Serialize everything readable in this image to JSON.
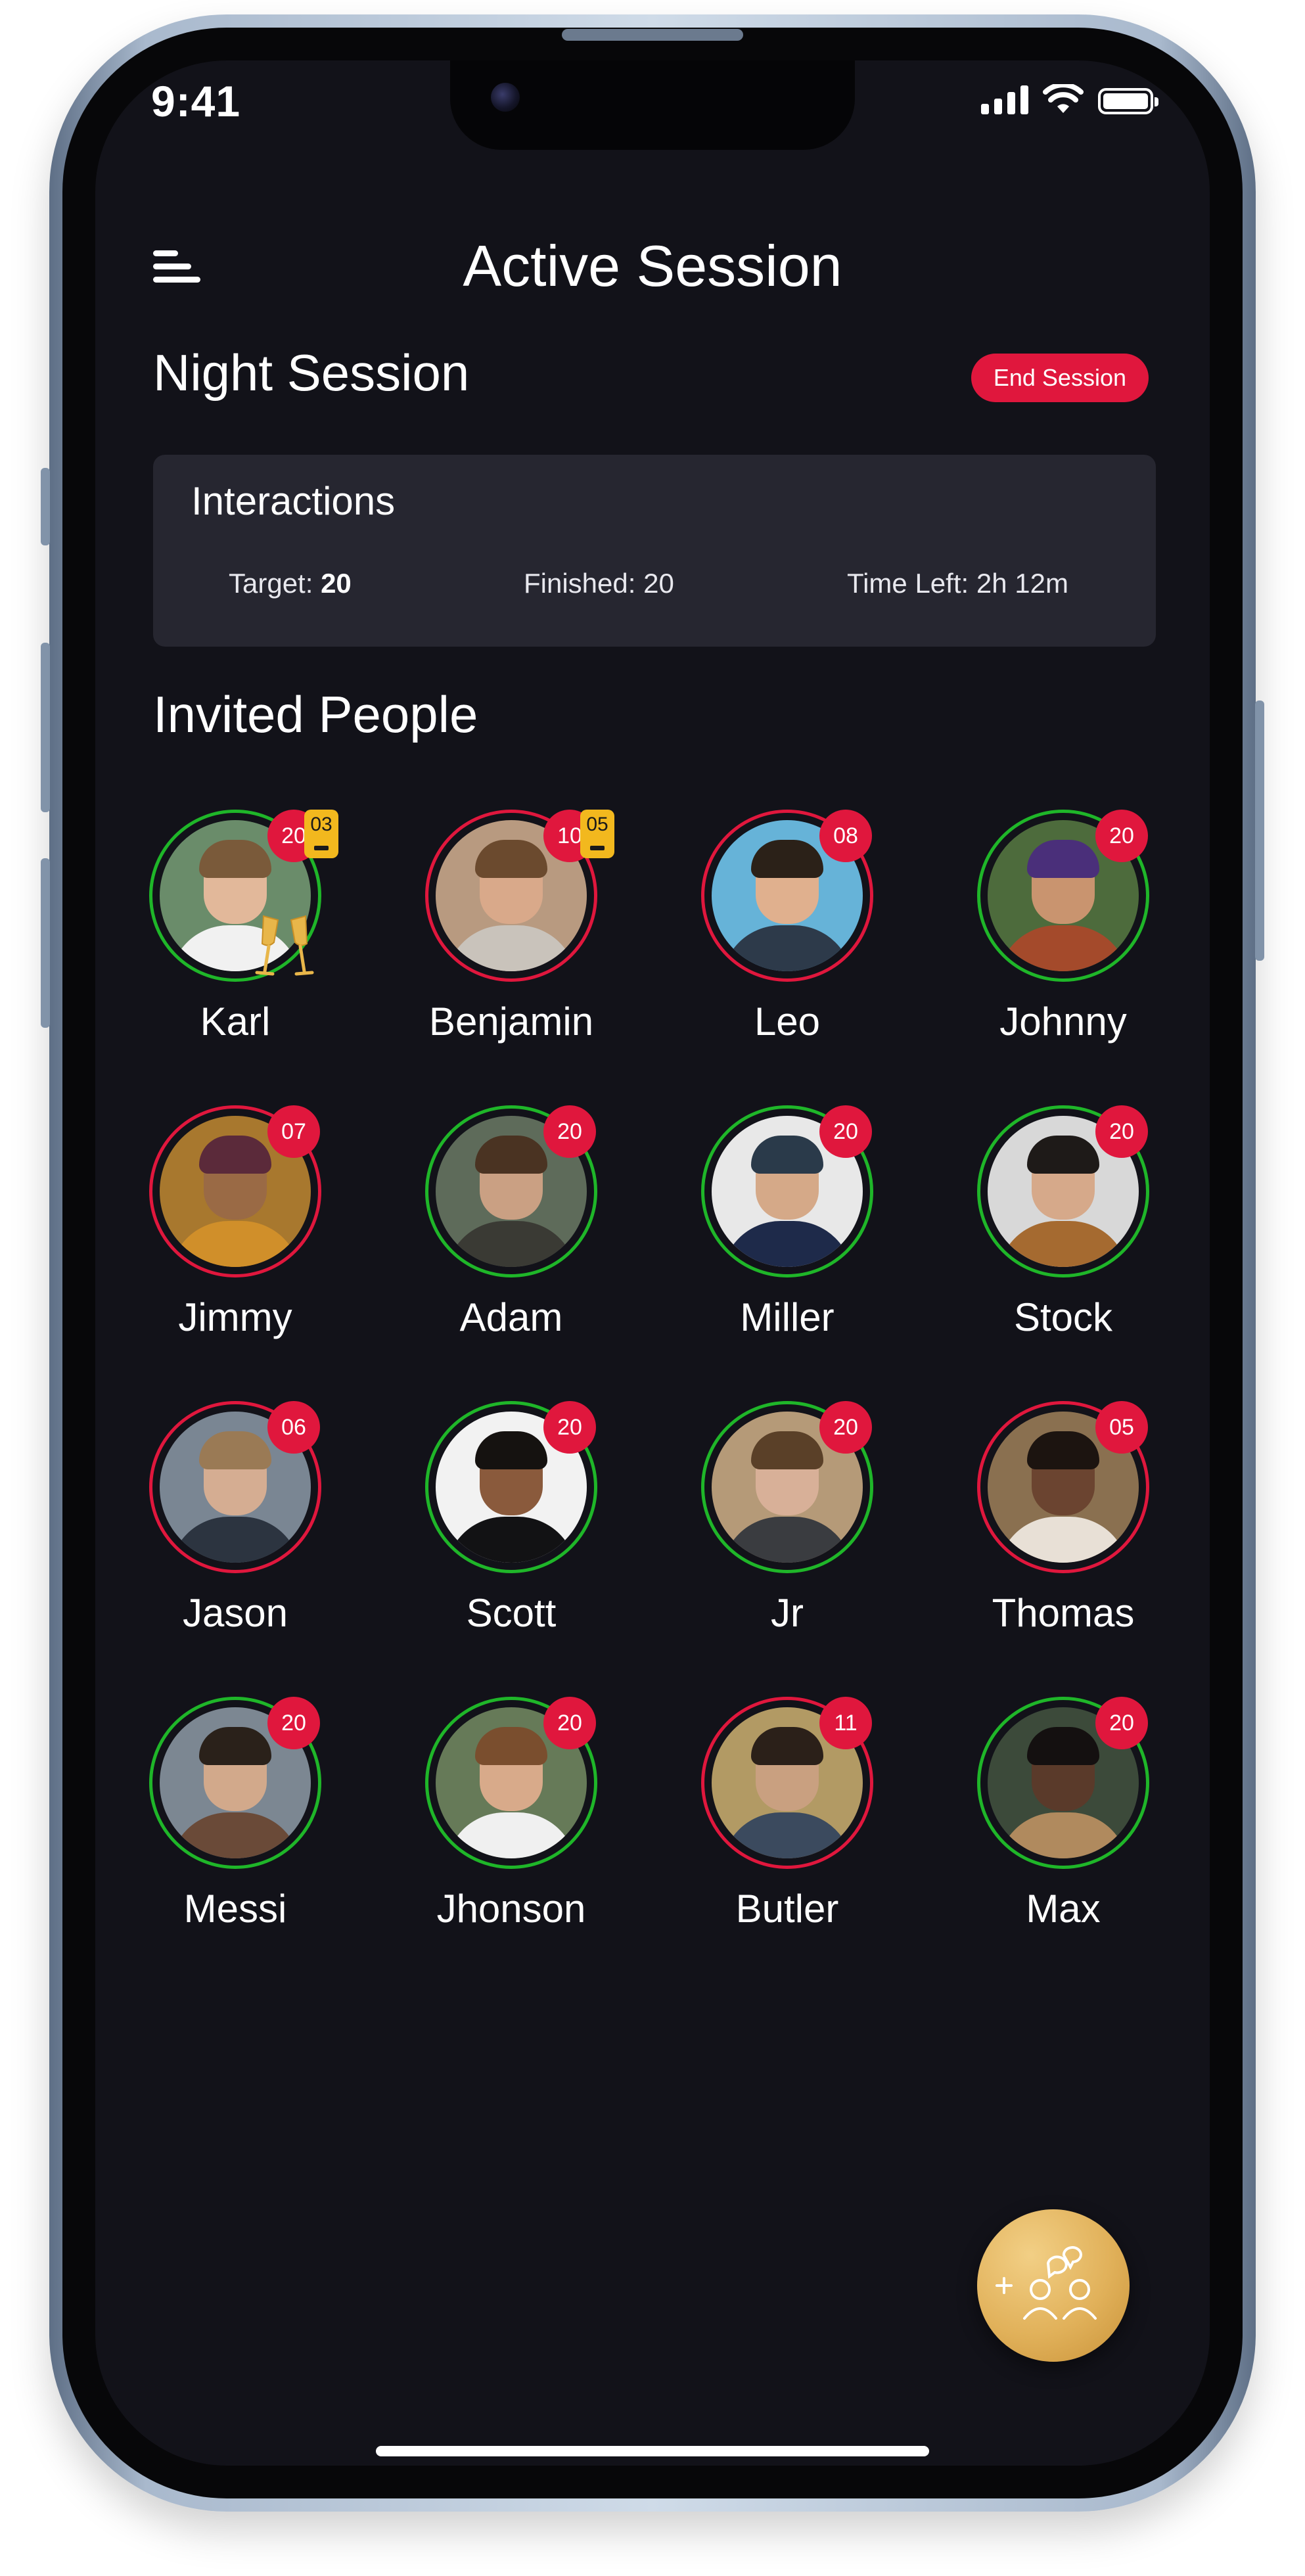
{
  "status_bar": {
    "time": "9:41"
  },
  "header": {
    "title": "Active Session"
  },
  "session": {
    "name": "Night Session",
    "end_label": "End Session"
  },
  "interactions": {
    "title": "Interactions",
    "target_label": "Target: ",
    "target_value": "20",
    "finished_label": "Finished: ",
    "finished_value": "20",
    "time_left_label": "Time Left: ",
    "time_left_value": "2h 12m"
  },
  "invited": {
    "title": "Invited People",
    "people": [
      {
        "name": "Karl",
        "count": "20",
        "drinks": "03",
        "ring": "#1fb629",
        "skin": "#e2b89a",
        "hair": "#7a5a3a",
        "shirt": "#f1f1f1",
        "bg": "#6a8c6a",
        "glasses_icon": true
      },
      {
        "name": "Benjamin",
        "count": "10",
        "drinks": "05",
        "ring": "#e0173d",
        "skin": "#d9a98a",
        "hair": "#6b4a2e",
        "shirt": "#c9c3bb",
        "bg": "#b89a80",
        "glasses_icon": false
      },
      {
        "name": "Leo",
        "count": "08",
        "ring": "#e0173d",
        "skin": "#e0b08e",
        "hair": "#2b2118",
        "shirt": "#2d3a4a",
        "bg": "#66b3d8",
        "glasses_icon": false
      },
      {
        "name": "Johnny",
        "count": "20",
        "ring": "#1fb629",
        "skin": "#c9946f",
        "hair": "#4a2f7a",
        "shirt": "#a44a2b",
        "bg": "#4d6b3c",
        "glasses_icon": false
      },
      {
        "name": "Jimmy",
        "count": "07",
        "ring": "#e0173d",
        "skin": "#9a6a45",
        "hair": "#5b2a3a",
        "shirt": "#d08f2a",
        "bg": "#a8782e",
        "glasses_icon": false
      },
      {
        "name": "Adam",
        "count": "20",
        "ring": "#1fb629",
        "skin": "#caa083",
        "hair": "#4a3322",
        "shirt": "#3a3a34",
        "bg": "#5e6b5a",
        "glasses_icon": false
      },
      {
        "name": "Miller",
        "count": "20",
        "ring": "#1fb629",
        "skin": "#d5a988",
        "hair": "#2a3a4a",
        "shirt": "#1e2a4a",
        "bg": "#e8e8e8",
        "glasses_icon": false
      },
      {
        "name": "Stock",
        "count": "20",
        "ring": "#1fb629",
        "skin": "#d6a98a",
        "hair": "#1e1a18",
        "shirt": "#a56a30",
        "bg": "#d8d8d8",
        "glasses_icon": false
      },
      {
        "name": "Jason",
        "count": "06",
        "ring": "#e0173d",
        "skin": "#d5ad92",
        "hair": "#9a7a55",
        "shirt": "#2c3440",
        "bg": "#7a8693",
        "glasses_icon": false
      },
      {
        "name": "Scott",
        "count": "20",
        "ring": "#1fb629",
        "skin": "#8a5a3c",
        "hair": "#151210",
        "shirt": "#121214",
        "bg": "#f2f2f2",
        "glasses_icon": false
      },
      {
        "name": "Jr",
        "count": "20",
        "ring": "#1fb629",
        "skin": "#d8b098",
        "hair": "#5a4028",
        "shirt": "#3a3c40",
        "bg": "#b59a78",
        "glasses_icon": false
      },
      {
        "name": "Thomas",
        "count": "05",
        "ring": "#e0173d",
        "skin": "#6b4430",
        "hair": "#1c1410",
        "shirt": "#e8e0d6",
        "bg": "#8a7050",
        "glasses_icon": false
      },
      {
        "name": "Messi",
        "count": "20",
        "ring": "#1fb629",
        "skin": "#d2a98b",
        "hair": "#2a211a",
        "shirt": "#6a4a38",
        "bg": "#7c8792",
        "glasses_icon": false
      },
      {
        "name": "Jhonson",
        "count": "20",
        "ring": "#1fb629",
        "skin": "#d8aa8a",
        "hair": "#7a4e2e",
        "shirt": "#f0f0f0",
        "bg": "#667a58",
        "glasses_icon": false
      },
      {
        "name": "Butler",
        "count": "11",
        "ring": "#e0173d",
        "skin": "#c9a080",
        "hair": "#2b2019",
        "shirt": "#3b4a5e",
        "bg": "#b29a64",
        "glasses_icon": false
      },
      {
        "name": "Max",
        "count": "20",
        "ring": "#1fb629",
        "skin": "#5a3a2a",
        "hair": "#141010",
        "shirt": "#b08a5e",
        "bg": "#3c4a3a",
        "glasses_icon": false
      }
    ]
  },
  "fab": {
    "icon": "add-people-chat-icon"
  },
  "colors": {
    "accent_red": "#e0173d",
    "ring_green": "#1fb629",
    "gold": "#e1b15a",
    "background": "#121219",
    "card": "#262630"
  }
}
